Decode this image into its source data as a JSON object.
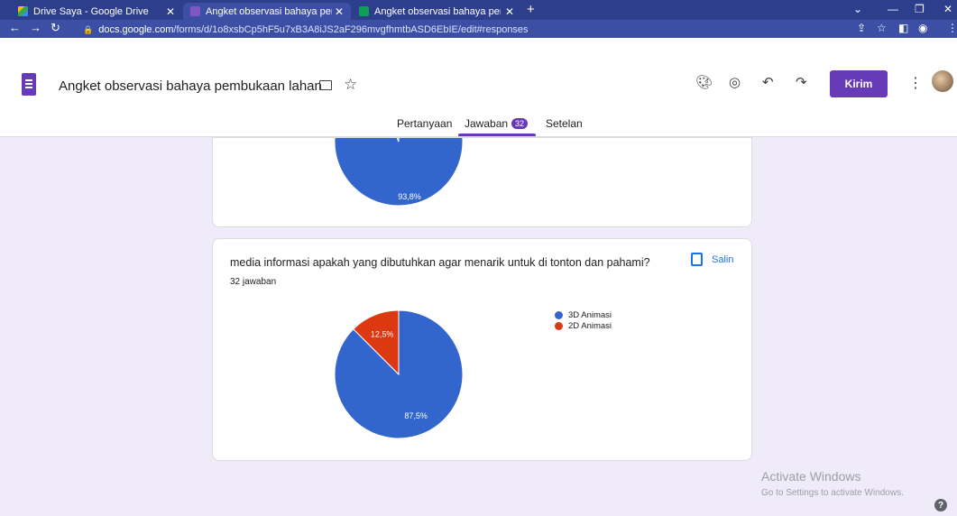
{
  "browser": {
    "tabs": [
      {
        "label": "Drive Saya - Google Drive",
        "icon": "google-drive-icon"
      },
      {
        "label": "Angket observasi bahaya pembu",
        "icon": "google-forms-icon"
      },
      {
        "label": "Angket observasi bahaya pembu",
        "icon": "google-sheets-icon"
      }
    ],
    "url_host": "docs.google.com",
    "url_path": "/forms/d/1o8xsbCp5hF5u7xB3A8iJS2aF296mvgfhmtbASD6EbIE/edit#responses"
  },
  "form": {
    "title": "Angket observasi bahaya pembukaan lahan",
    "send_label": "Kirim",
    "tabs": {
      "questions": "Pertanyaan",
      "responses": "Jawaban",
      "responses_count": "32",
      "settings": "Setelan"
    }
  },
  "cards": {
    "previous": {
      "visible_label": "93,8%"
    },
    "media": {
      "question": "media informasi apakah yang dibutuhkan agar menarik untuk di tonton dan pahami?",
      "count": "32 jawaban",
      "copy_label": "Salin"
    }
  },
  "chart_data": [
    {
      "type": "pie",
      "values": [
        93.8,
        6.2
      ],
      "colors": [
        "#3366cc",
        "#dc3912"
      ],
      "labels": [
        "93,8%",
        ""
      ]
    },
    {
      "type": "pie",
      "categories": [
        "3D Animasi",
        "2D Animasi"
      ],
      "values": [
        87.5,
        12.5
      ],
      "colors": [
        "#3366cc",
        "#dc3912"
      ],
      "labels": [
        "87,5%",
        "12,5%"
      ],
      "legend": "right"
    }
  ],
  "watermark": {
    "line1": "Activate Windows",
    "line2": "Go to Settings to activate Windows."
  },
  "colors": {
    "accent": "#673ab7",
    "tabstrip": "#2d3e8c",
    "page_bg": "#f0ebf8"
  }
}
